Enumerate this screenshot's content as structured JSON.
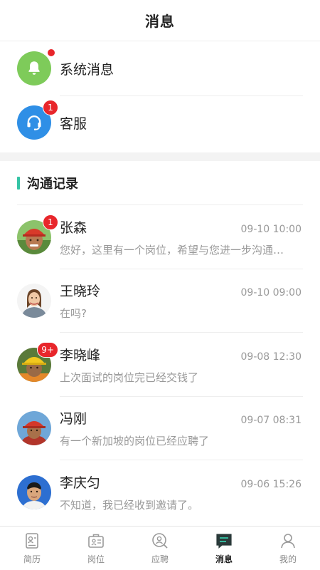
{
  "header": {
    "title": "消息"
  },
  "system": [
    {
      "label": "系统消息",
      "icon": "bell-icon",
      "indicator": "dot"
    },
    {
      "label": "客服",
      "icon": "headset-icon",
      "badge": "1"
    }
  ],
  "section": {
    "title": "沟通记录"
  },
  "chats": [
    {
      "name": "张森",
      "time": "09-10 10:00",
      "message": "您好，这里有一个岗位，希望与您进一步沟通…",
      "badge": "1"
    },
    {
      "name": "王晓玲",
      "time": "09-10 09:00",
      "message": "在吗?",
      "badge": ""
    },
    {
      "name": "李晓峰",
      "time": "09-08 12:30",
      "message": "上次面试的岗位完已经交钱了",
      "badge": "9+"
    },
    {
      "name": "冯刚",
      "time": "09-07 08:31",
      "message": "有一个新加坡的岗位已经应聘了",
      "badge": ""
    },
    {
      "name": "李庆匀",
      "time": "09-06 15:26",
      "message": "不知道，我已经收到邀请了。",
      "badge": ""
    }
  ],
  "tabs": [
    {
      "label": "简历",
      "icon": "resume-icon",
      "active": false
    },
    {
      "label": "岗位",
      "icon": "briefcase-icon",
      "active": false
    },
    {
      "label": "应聘",
      "icon": "search-person-icon",
      "active": false
    },
    {
      "label": "消息",
      "icon": "message-icon",
      "active": true
    },
    {
      "label": "我的",
      "icon": "user-icon",
      "active": false
    }
  ],
  "colors": {
    "accent": "#35c4a5",
    "badge": "#e8262b",
    "bell": "#7ecb5a",
    "service": "#2f8fe6"
  }
}
